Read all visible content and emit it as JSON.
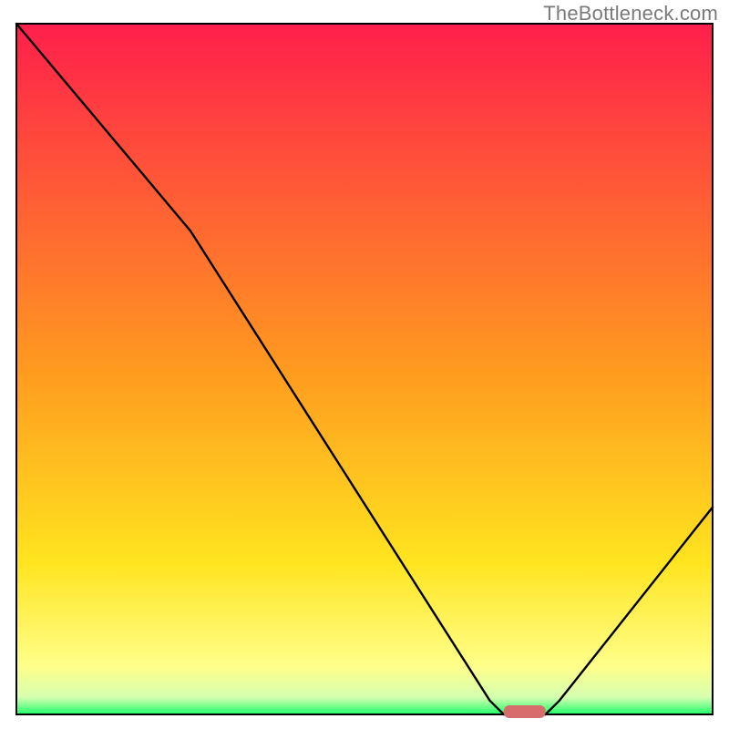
{
  "watermark": "TheBottleneck.com",
  "chart_data": {
    "type": "line",
    "title": "",
    "xlabel": "",
    "ylabel": "",
    "xlim": [
      0,
      100
    ],
    "ylim": [
      0,
      100
    ],
    "x": [
      0,
      25,
      68,
      70,
      76,
      78,
      100
    ],
    "values": [
      100,
      70,
      2,
      0,
      0,
      2,
      30
    ],
    "sweet_spot": {
      "x_start": 70,
      "x_end": 76
    },
    "gradient_stops": [
      {
        "offset": 0.0,
        "color": "#ff1f4b"
      },
      {
        "offset": 0.5,
        "color": "#ff9a1f"
      },
      {
        "offset": 0.78,
        "color": "#ffe41f"
      },
      {
        "offset": 0.93,
        "color": "#ffff8a"
      },
      {
        "offset": 0.975,
        "color": "#d6ffb0"
      },
      {
        "offset": 1.0,
        "color": "#1fff6b"
      }
    ],
    "marker_color": "#d86b6b"
  }
}
